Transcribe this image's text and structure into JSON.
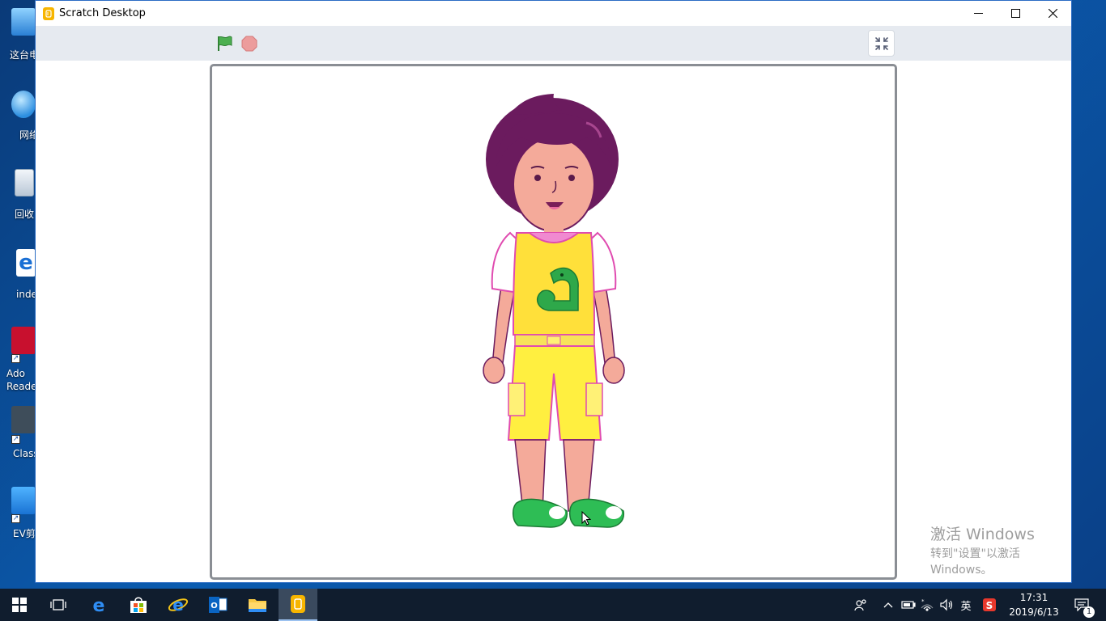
{
  "desktop": {
    "icons": [
      {
        "label": "这台电",
        "icon": "this-pc-icon"
      },
      {
        "label": "网络",
        "icon": "network-icon"
      },
      {
        "label": "回收",
        "icon": "recycle-bin-icon"
      },
      {
        "label": "inde",
        "icon": "ie-shortcut-icon"
      },
      {
        "label": "Ado\nReade",
        "icon": "adobe-reader-icon"
      },
      {
        "label": "Class",
        "icon": "classin-icon"
      },
      {
        "label": "EV剪",
        "icon": "ev-editor-icon"
      }
    ]
  },
  "window": {
    "title": "Scratch Desktop",
    "controls": {
      "minimize": "minimize-icon",
      "maximize": "maximize-icon",
      "close": "close-icon"
    }
  },
  "toolbar": {
    "green_flag": "green-flag-icon",
    "stop": "stop-icon",
    "unfullscreen": "unfullscreen-icon"
  },
  "stage": {
    "sprite": "boy-character-sprite"
  },
  "watermark": {
    "line1": "激活 Windows",
    "line2": "转到\"设置\"以激活 Windows。"
  },
  "taskbar": {
    "apps": [
      "start-icon",
      "task-view-icon",
      "edge-icon",
      "store-icon",
      "ie-icon",
      "outlook-icon",
      "file-explorer-icon",
      "scratch-icon"
    ],
    "tray": {
      "ime": "英",
      "time": "17:31",
      "date": "2019/6/13",
      "notifications": "1"
    }
  },
  "colors": {
    "taskbar": "#101d2e",
    "toolbar": "#e6eaf0",
    "flag": "#4caf50",
    "stop": "#ec9c9c",
    "titlebar_border": "#2b6cc4"
  }
}
